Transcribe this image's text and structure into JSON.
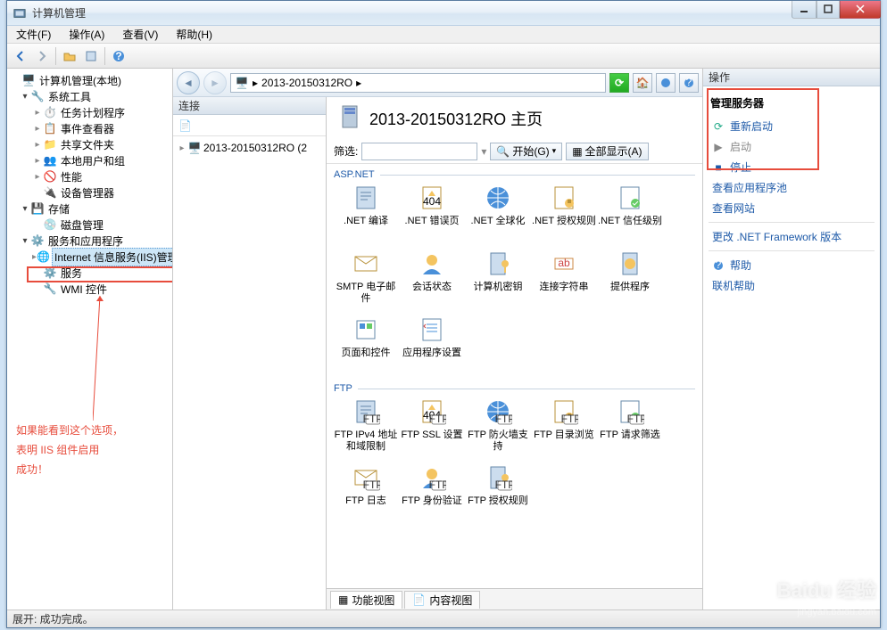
{
  "window": {
    "title": "计算机管理"
  },
  "menu": {
    "file": "文件(F)",
    "action": "操作(A)",
    "view": "查看(V)",
    "help": "帮助(H)"
  },
  "tree": {
    "root": "计算机管理(本地)",
    "sys": "系统工具",
    "sys_items": [
      "任务计划程序",
      "事件查看器",
      "共享文件夹",
      "本地用户和组",
      "性能",
      "设备管理器"
    ],
    "storage": "存储",
    "storage_items": [
      "磁盘管理"
    ],
    "services": "服务和应用程序",
    "svc_items": [
      "Internet 信息服务(IIS)管理器",
      "服务",
      "WMI 控件"
    ]
  },
  "annotation": {
    "line1": "如果能看到这个选项，",
    "line2": "表明 IIS 组件启用",
    "line3": "成功！"
  },
  "address": {
    "crumb": "2013-20150312RO",
    "arrow": "▸"
  },
  "conn": {
    "header": "连接",
    "server": "2013-20150312RO (2"
  },
  "features": {
    "title": "2013-20150312RO 主页",
    "filter_label": "筛选:",
    "go_label": "开始(G)",
    "showall_label": "全部显示(A)",
    "group_aspnet": "ASP.NET",
    "group_ftp": "FTP",
    "aspnet_items": [
      ".NET 编译",
      ".NET 错误页",
      ".NET 全球化",
      ".NET 授权规则",
      ".NET 信任级别",
      "SMTP 电子邮件",
      "会话状态",
      "计算机密钥",
      "连接字符串",
      "提供程序",
      "页面和控件",
      "应用程序设置"
    ],
    "ftp_items": [
      "FTP IPv4 地址和域限制",
      "FTP SSL 设置",
      "FTP 防火墙支持",
      "FTP 目录浏览",
      "FTP 请求筛选",
      "FTP 日志",
      "FTP 身份验证",
      "FTP 授权规则"
    ],
    "tab_features": "功能视图",
    "tab_content": "内容视图"
  },
  "actions": {
    "header": "操作",
    "manage": "管理服务器",
    "restart": "重新启动",
    "start": "启动",
    "stop": "停止",
    "apppools": "查看应用程序池",
    "sites": "查看网站",
    "netfx": "更改 .NET Framework 版本",
    "help": "帮助",
    "online": "联机帮助"
  },
  "status": {
    "text": "展开: 成功完成。"
  },
  "watermark": {
    "brand": "Baidu 经验",
    "url": "jingyan.baidu.com"
  }
}
